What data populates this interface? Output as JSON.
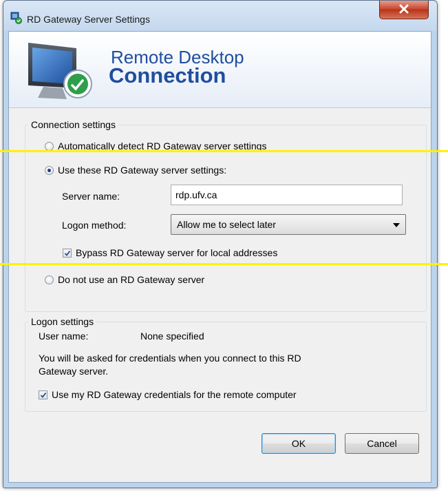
{
  "window": {
    "title": "RD Gateway Server Settings"
  },
  "banner": {
    "line1": "Remote Desktop",
    "line2": "Connection"
  },
  "connection_settings": {
    "legend": "Connection settings",
    "option_auto": "Automatically detect RD Gateway server settings",
    "option_use": "Use these RD Gateway server settings:",
    "selected_option": "use",
    "server_name_label": "Server name:",
    "server_name_value": "rdp.ufv.ca",
    "logon_method_label": "Logon method:",
    "logon_method_value": "Allow me to select later",
    "bypass_label": "Bypass RD Gateway server for local addresses",
    "bypass_checked": true,
    "option_none": "Do not use an RD Gateway server"
  },
  "logon_settings": {
    "legend": "Logon settings",
    "user_name_label": "User name:",
    "user_name_value": "None specified",
    "info_line1": "You will be asked for credentials when you connect to this RD",
    "info_line2": "Gateway server.",
    "use_credentials_label": "Use my RD Gateway credentials for the remote computer",
    "use_credentials_checked": true
  },
  "buttons": {
    "ok": "OK",
    "cancel": "Cancel"
  },
  "annotation": {
    "highlight_color": "#fff200"
  },
  "colors": {
    "banner_text": "#1f4e9e",
    "close_button": "#c7452b"
  },
  "icons": {
    "title": "rd-gateway-icon",
    "banner": "remote-desktop-monitor-icon",
    "close": "close-icon",
    "dropdown": "chevron-down-icon",
    "check": "checkmark-icon"
  }
}
